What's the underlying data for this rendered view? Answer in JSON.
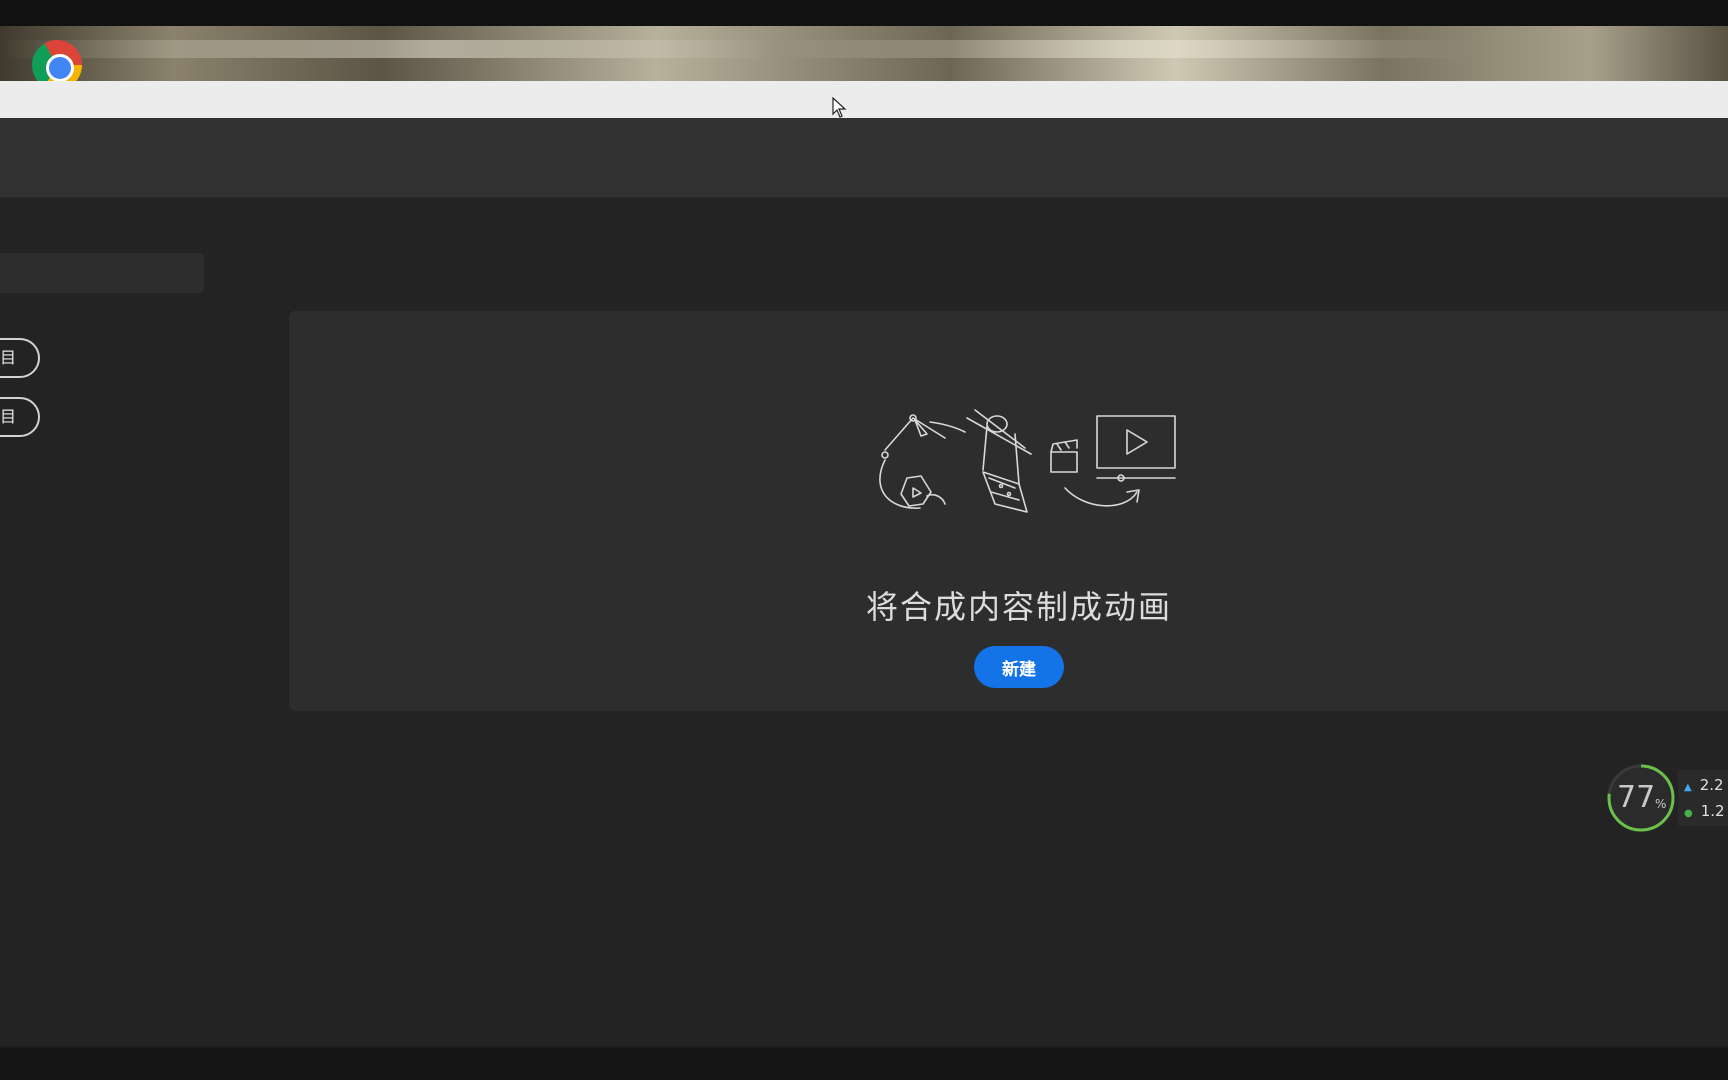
{
  "sidebar": {
    "buttons": [
      {
        "label": "项目"
      },
      {
        "label": "项目"
      }
    ]
  },
  "empty_state": {
    "title": "将合成内容制成动画",
    "new_button_label": "新建"
  },
  "network_widget": {
    "percent": "77",
    "percent_sign": "%",
    "upload": "2.2",
    "download": "1.2"
  },
  "icons": {
    "browser": "chrome-icon",
    "cursor": "mouse-cursor-icon",
    "illustration": "animation-illustration-icon"
  },
  "colors": {
    "accent": "#1473e6",
    "app_background": "#232323",
    "card_background": "#2d2d2d",
    "header_background": "#323232"
  }
}
